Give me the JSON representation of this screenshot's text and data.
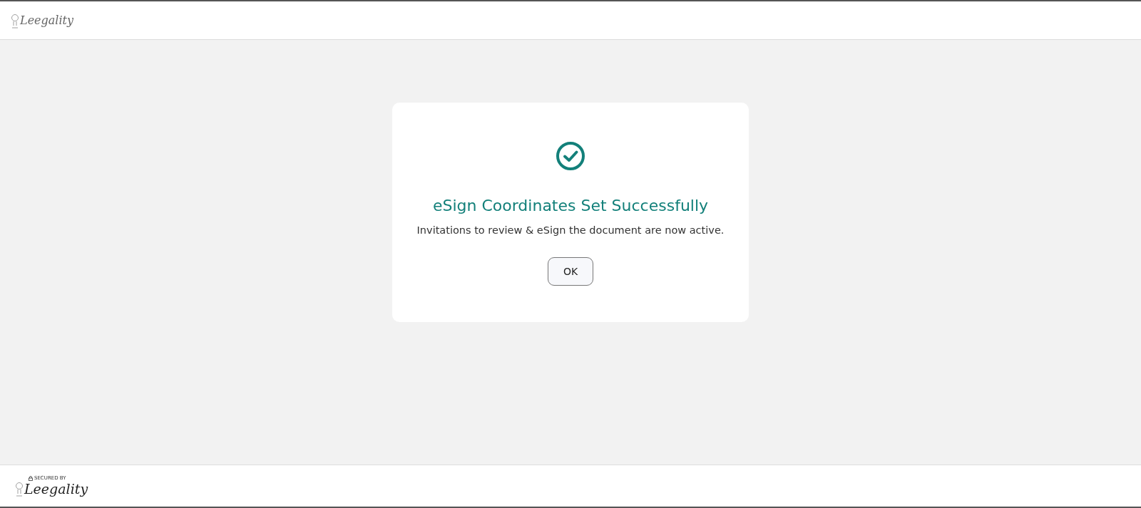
{
  "header": {
    "logo": "Leegality"
  },
  "dialog": {
    "title": "eSign Coordinates Set Successfully",
    "message": "Invitations to review & eSign the document are now active.",
    "button": "OK"
  },
  "footer": {
    "secured_label": "SECURED BY",
    "logo": "Leegality"
  }
}
